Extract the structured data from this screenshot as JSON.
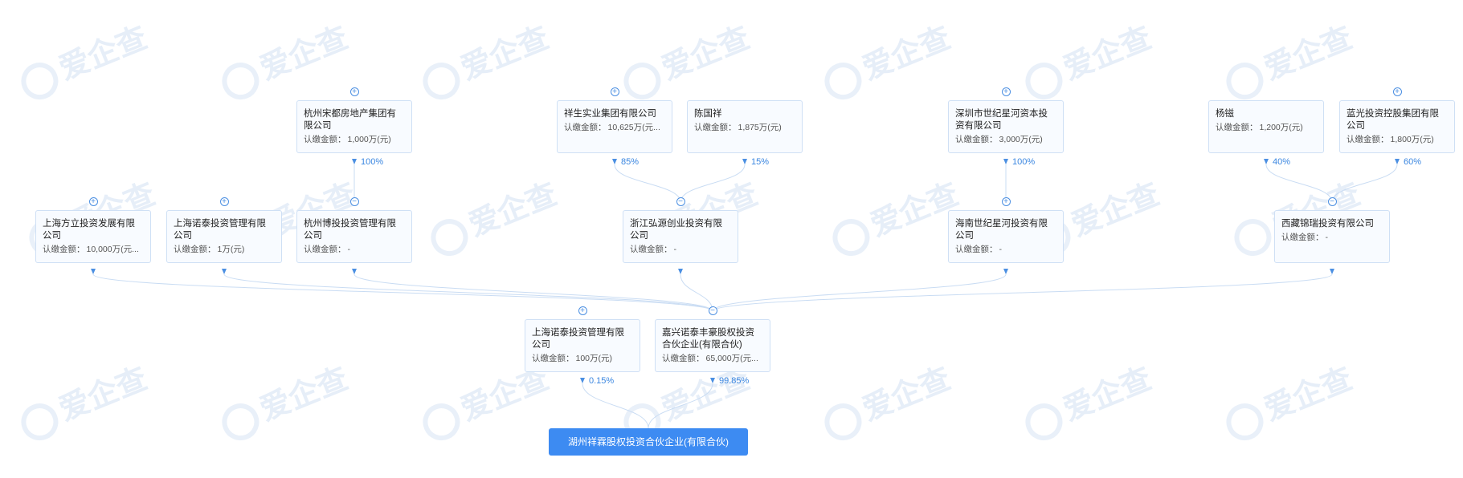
{
  "watermark": {
    "text": "爱企查"
  },
  "target": {
    "name": "湖州祥霖股权投资合伙企业(有限合伙)"
  },
  "amount_label": "认缴金额：",
  "toggle_symbols": {
    "expand": "+",
    "collapse": "−"
  },
  "nodes": {
    "hz_songdu": {
      "name": "杭州宋都房地产集团有限公司",
      "amount": "1,000万(元)",
      "toggle": "expand",
      "percent": "100%"
    },
    "xiangsheng": {
      "name": "祥生实业集团有限公司",
      "amount": "10,625万(元...",
      "toggle": "expand",
      "percent": "85%"
    },
    "chen_guoxiang": {
      "name": "陈国祥",
      "amount": "1,875万(元)",
      "toggle": null,
      "percent": "15%"
    },
    "sz_shiji": {
      "name": "深圳市世纪星河资本投资有限公司",
      "amount": "3,000万(元)",
      "toggle": "expand",
      "percent": "100%"
    },
    "yang_tao": {
      "name": "杨镃",
      "amount": "1,200万(元)",
      "toggle": null,
      "percent": "40%"
    },
    "languang": {
      "name": "蓝光投资控股集团有限公司",
      "amount": "1,800万(元)",
      "toggle": "expand",
      "percent": "60%"
    },
    "sh_fangli": {
      "name": "上海方立投资发展有限公司",
      "amount": "10,000万(元...",
      "toggle": "expand",
      "percent": ""
    },
    "sh_nuotai_a": {
      "name": "上海诺泰投资管理有限公司",
      "amount": "1万(元)",
      "toggle": "expand",
      "percent": ""
    },
    "hz_bo": {
      "name": "杭州博投投资管理有限公司",
      "amount": "-",
      "toggle": "collapse",
      "percent": ""
    },
    "zj_hongyuan": {
      "name": "浙江弘源创业投资有限公司",
      "amount": "-",
      "toggle": "collapse",
      "percent": ""
    },
    "hn_shiji": {
      "name": "海南世纪星河投资有限公司",
      "amount": "-",
      "toggle": "expand",
      "percent": ""
    },
    "xz_jinrui": {
      "name": "西藏锦瑞投资有限公司",
      "amount": "-",
      "toggle": "collapse",
      "percent": ""
    },
    "sh_nuotai_b": {
      "name": "上海诺泰投资管理有限公司",
      "amount": "100万(元)",
      "toggle": "expand",
      "percent": "0.15%"
    },
    "jx_nuotai": {
      "name": "嘉兴诺泰丰豪股权投资合伙企业(有限合伙)",
      "amount": "65,000万(元...",
      "toggle": "collapse",
      "percent": "99.85%"
    }
  }
}
